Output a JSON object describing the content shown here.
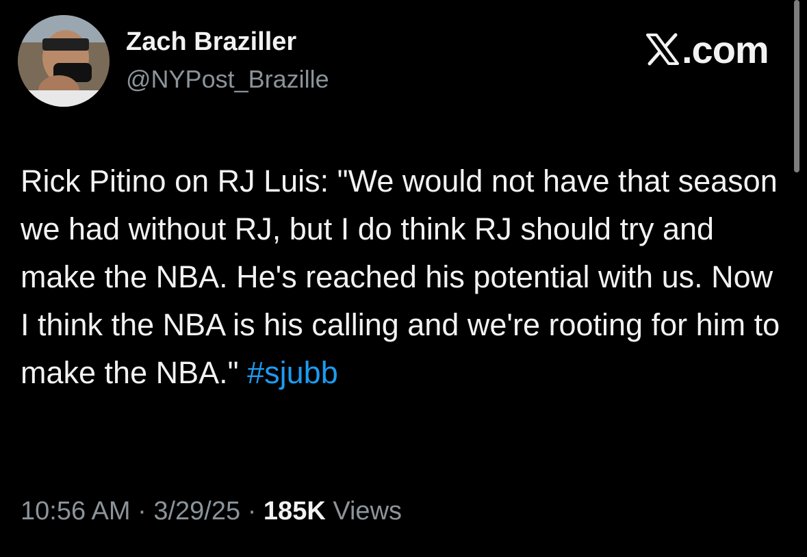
{
  "author": {
    "name": "Zach Braziller",
    "handle": "@NYPost_Brazille"
  },
  "brand": {
    "logo_text": ".com",
    "logo_icon": "x-logo-icon"
  },
  "tweet": {
    "text": "Rick Pitino on RJ Luis: \"We would not have that season we had without RJ, but I do think RJ should try and make the NBA. He's reached his potential with us. Now I think the NBA is his calling and we're rooting for him to make the NBA.\"",
    "hashtag": "#sjubb"
  },
  "meta": {
    "time": "10:56 AM",
    "separator": "·",
    "date": "3/29/25",
    "views_count": "185K",
    "views_label": "Views"
  },
  "colors": {
    "background": "#000000",
    "text": "#f2f2f2",
    "secondary": "#8b949a",
    "hashtag": "#1d9bf0"
  }
}
